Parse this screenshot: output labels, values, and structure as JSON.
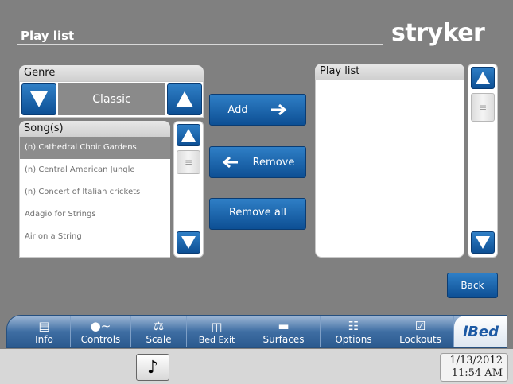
{
  "header": {
    "title": "Play list",
    "brand": "stryker"
  },
  "genre": {
    "label": "Genre",
    "value": "Classic"
  },
  "songs": {
    "label": "Song(s)",
    "items": [
      "(n) Cathedral Choir Gardens",
      "(n) Central American Jungle",
      "(n) Concert of Italian crickets",
      "Adagio for Strings",
      "Air on a String"
    ],
    "selected_index": 0
  },
  "actions": {
    "add_label": "Add",
    "remove_label": "Remove",
    "remove_all_label": "Remove all"
  },
  "playlist": {
    "label": "Play list",
    "items": []
  },
  "back_label": "Back",
  "nav": {
    "items": [
      {
        "label": "Info",
        "icon": "info-icon"
      },
      {
        "label": "Controls",
        "icon": "patient-icon"
      },
      {
        "label": "Scale",
        "icon": "scale-icon"
      },
      {
        "label": "Bed Exit",
        "icon": "bed-exit-icon"
      },
      {
        "label": "Surfaces",
        "icon": "mattress-icon"
      },
      {
        "label": "Options",
        "icon": "sliders-icon"
      },
      {
        "label": "Lockouts",
        "icon": "lock-icon"
      }
    ],
    "brand": "iBed"
  },
  "footer": {
    "date": "1/13/2012",
    "time": "11:54 AM"
  },
  "colors": {
    "background": "#808080",
    "button_blue": "#1f67b0",
    "nav_blue": "#3f6ea3"
  }
}
